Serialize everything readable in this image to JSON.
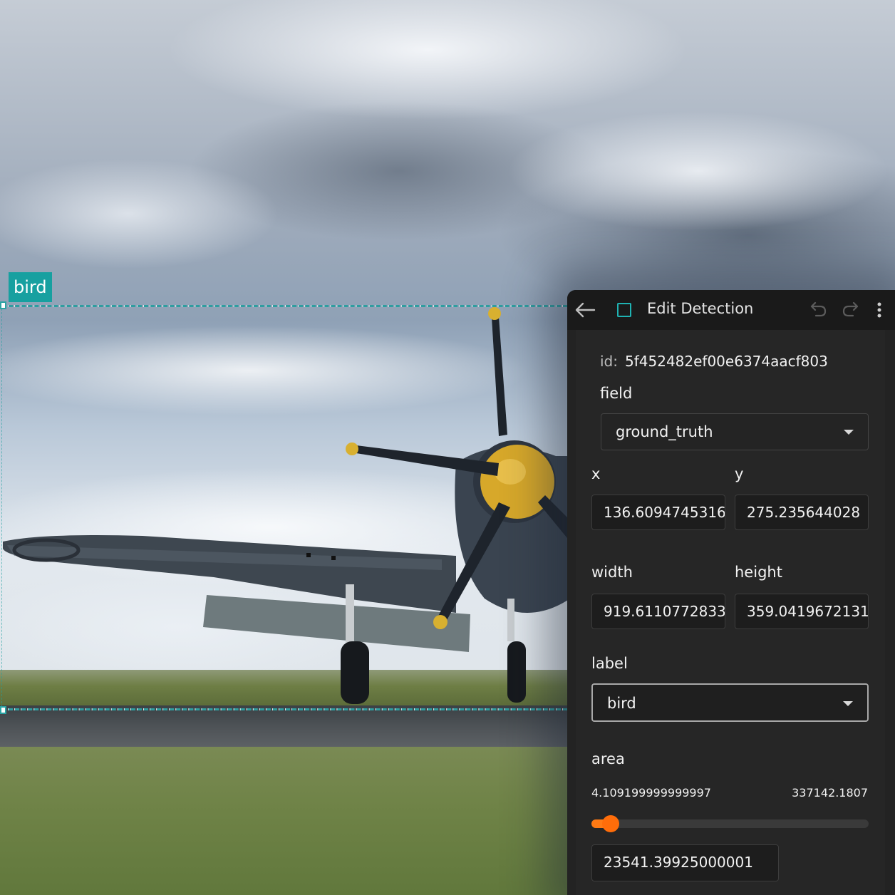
{
  "overlay": {
    "box_label": "bird"
  },
  "panel": {
    "title": "Edit Detection",
    "id_key": "id:",
    "id_value": "5f452482ef00e6374aacf803",
    "field_label": "field",
    "field_value": "ground_truth",
    "x_label": "x",
    "x_value": "136.6094745316",
    "y_label": "y",
    "y_value": "275.235644028",
    "width_label": "width",
    "width_value": "919.6110772833",
    "height_label": "height",
    "height_value": "359.0419672131",
    "label_label": "label",
    "label_value": "bird",
    "area_label": "area",
    "area_min": "4.109199999999997",
    "area_max": "337142.1807",
    "area_value": "23541.39925000001",
    "area_fraction": 0.07
  },
  "icons": {
    "back": "arrow-left-icon",
    "detection": "square-outline-icon",
    "undo": "undo-icon",
    "redo": "redo-icon",
    "more": "more-vertical-icon"
  },
  "colors": {
    "accent_teal": "#17a0a0",
    "slider_orange": "#ff7a14",
    "panel_bg": "#232323"
  }
}
